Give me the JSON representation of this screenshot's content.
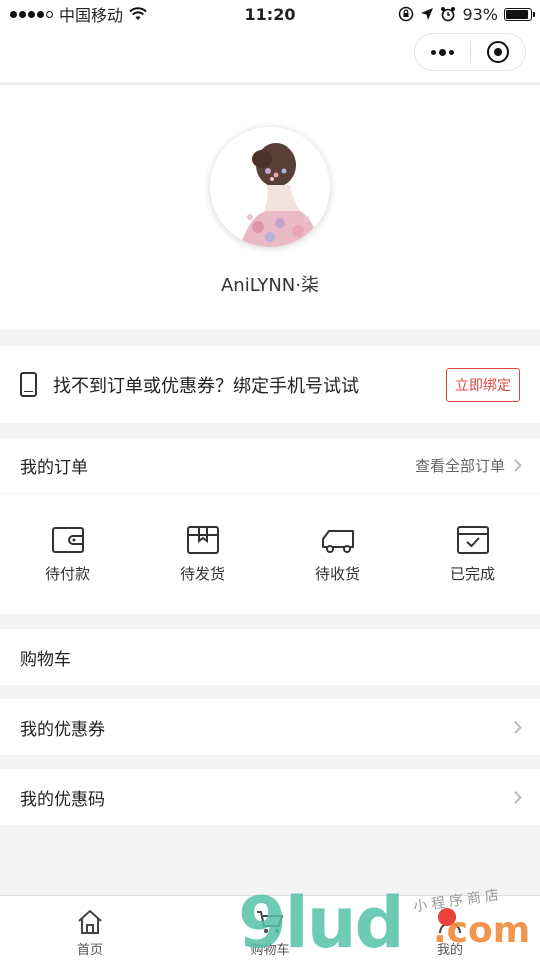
{
  "status_bar": {
    "carrier": "中国移动",
    "time": "11:20",
    "battery": "93%",
    "battery_level": 0.93,
    "signal_bars_filled": 4,
    "signal_bars_total": 5
  },
  "nav": {
    "more_icon": "more-dots-icon",
    "close_icon": "target-close-icon"
  },
  "profile": {
    "username": "AniLYNN·柒"
  },
  "bind": {
    "text": "找不到订单或优惠券？绑定手机号试试",
    "button": "立即绑定",
    "accent": "#e0473f"
  },
  "orders": {
    "title": "我的订单",
    "view_all": "查看全部订单",
    "items": [
      {
        "label": "待付款",
        "icon": "wallet-icon"
      },
      {
        "label": "待发货",
        "icon": "box-icon"
      },
      {
        "label": "待收货",
        "icon": "truck-icon"
      },
      {
        "label": "已完成",
        "icon": "completed-icon"
      }
    ]
  },
  "rows": {
    "cart": "购物车",
    "coupons": "我的优惠券",
    "coupon_codes": "我的优惠码"
  },
  "tabbar": {
    "items": [
      {
        "label": "首页",
        "icon": "home-icon"
      },
      {
        "label": "购物车",
        "icon": "cart-icon"
      },
      {
        "label": "我的",
        "icon": "profile-icon"
      }
    ]
  },
  "watermark": {
    "big": "9lud",
    "com": ".com",
    "small": "小程序商店"
  }
}
